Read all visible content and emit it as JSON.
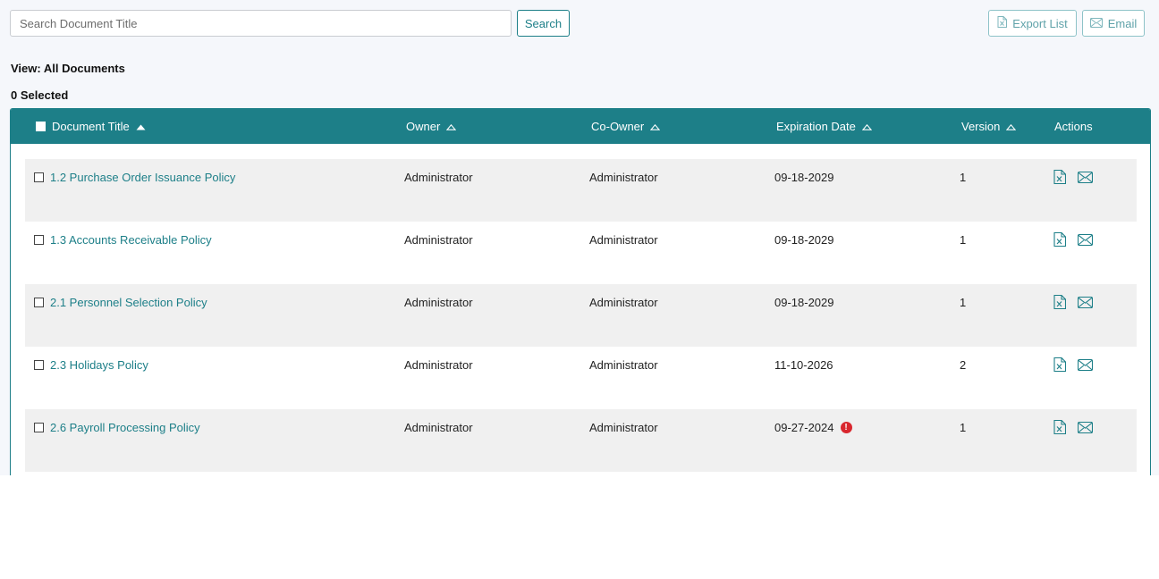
{
  "toolbar": {
    "search_placeholder": "Search Document Title",
    "search_value": "",
    "search_label": "Search",
    "export_label": "Export List",
    "email_label": "Email"
  },
  "view_label": "View: All Documents",
  "selected_label": "0 Selected",
  "colors": {
    "accent": "#1d7f88",
    "row_alt": "#f0f0f0",
    "warning": "#d9272e"
  },
  "table": {
    "headers": {
      "title": "Document Title",
      "owner": "Owner",
      "coowner": "Co-Owner",
      "expiration": "Expiration Date",
      "version": "Version",
      "actions": "Actions"
    },
    "sort": {
      "column": "title",
      "direction": "ascending"
    },
    "rows": [
      {
        "title": "1.2 Purchase Order Issuance Policy",
        "owner": "Administrator",
        "coowner": "Administrator",
        "expiration": "09-18-2029",
        "version": "1",
        "expired": false
      },
      {
        "title": "1.3 Accounts Receivable Policy",
        "owner": "Administrator",
        "coowner": "Administrator",
        "expiration": "09-18-2029",
        "version": "1",
        "expired": false
      },
      {
        "title": "2.1 Personnel Selection Policy",
        "owner": "Administrator",
        "coowner": "Administrator",
        "expiration": "09-18-2029",
        "version": "1",
        "expired": false
      },
      {
        "title": "2.3 Holidays Policy",
        "owner": "Administrator",
        "coowner": "Administrator",
        "expiration": "11-10-2026",
        "version": "2",
        "expired": false
      },
      {
        "title": "2.6 Payroll Processing Policy",
        "owner": "Administrator",
        "coowner": "Administrator",
        "expiration": "09-27-2024",
        "version": "1",
        "expired": true,
        "expired_icon": "!"
      }
    ]
  }
}
